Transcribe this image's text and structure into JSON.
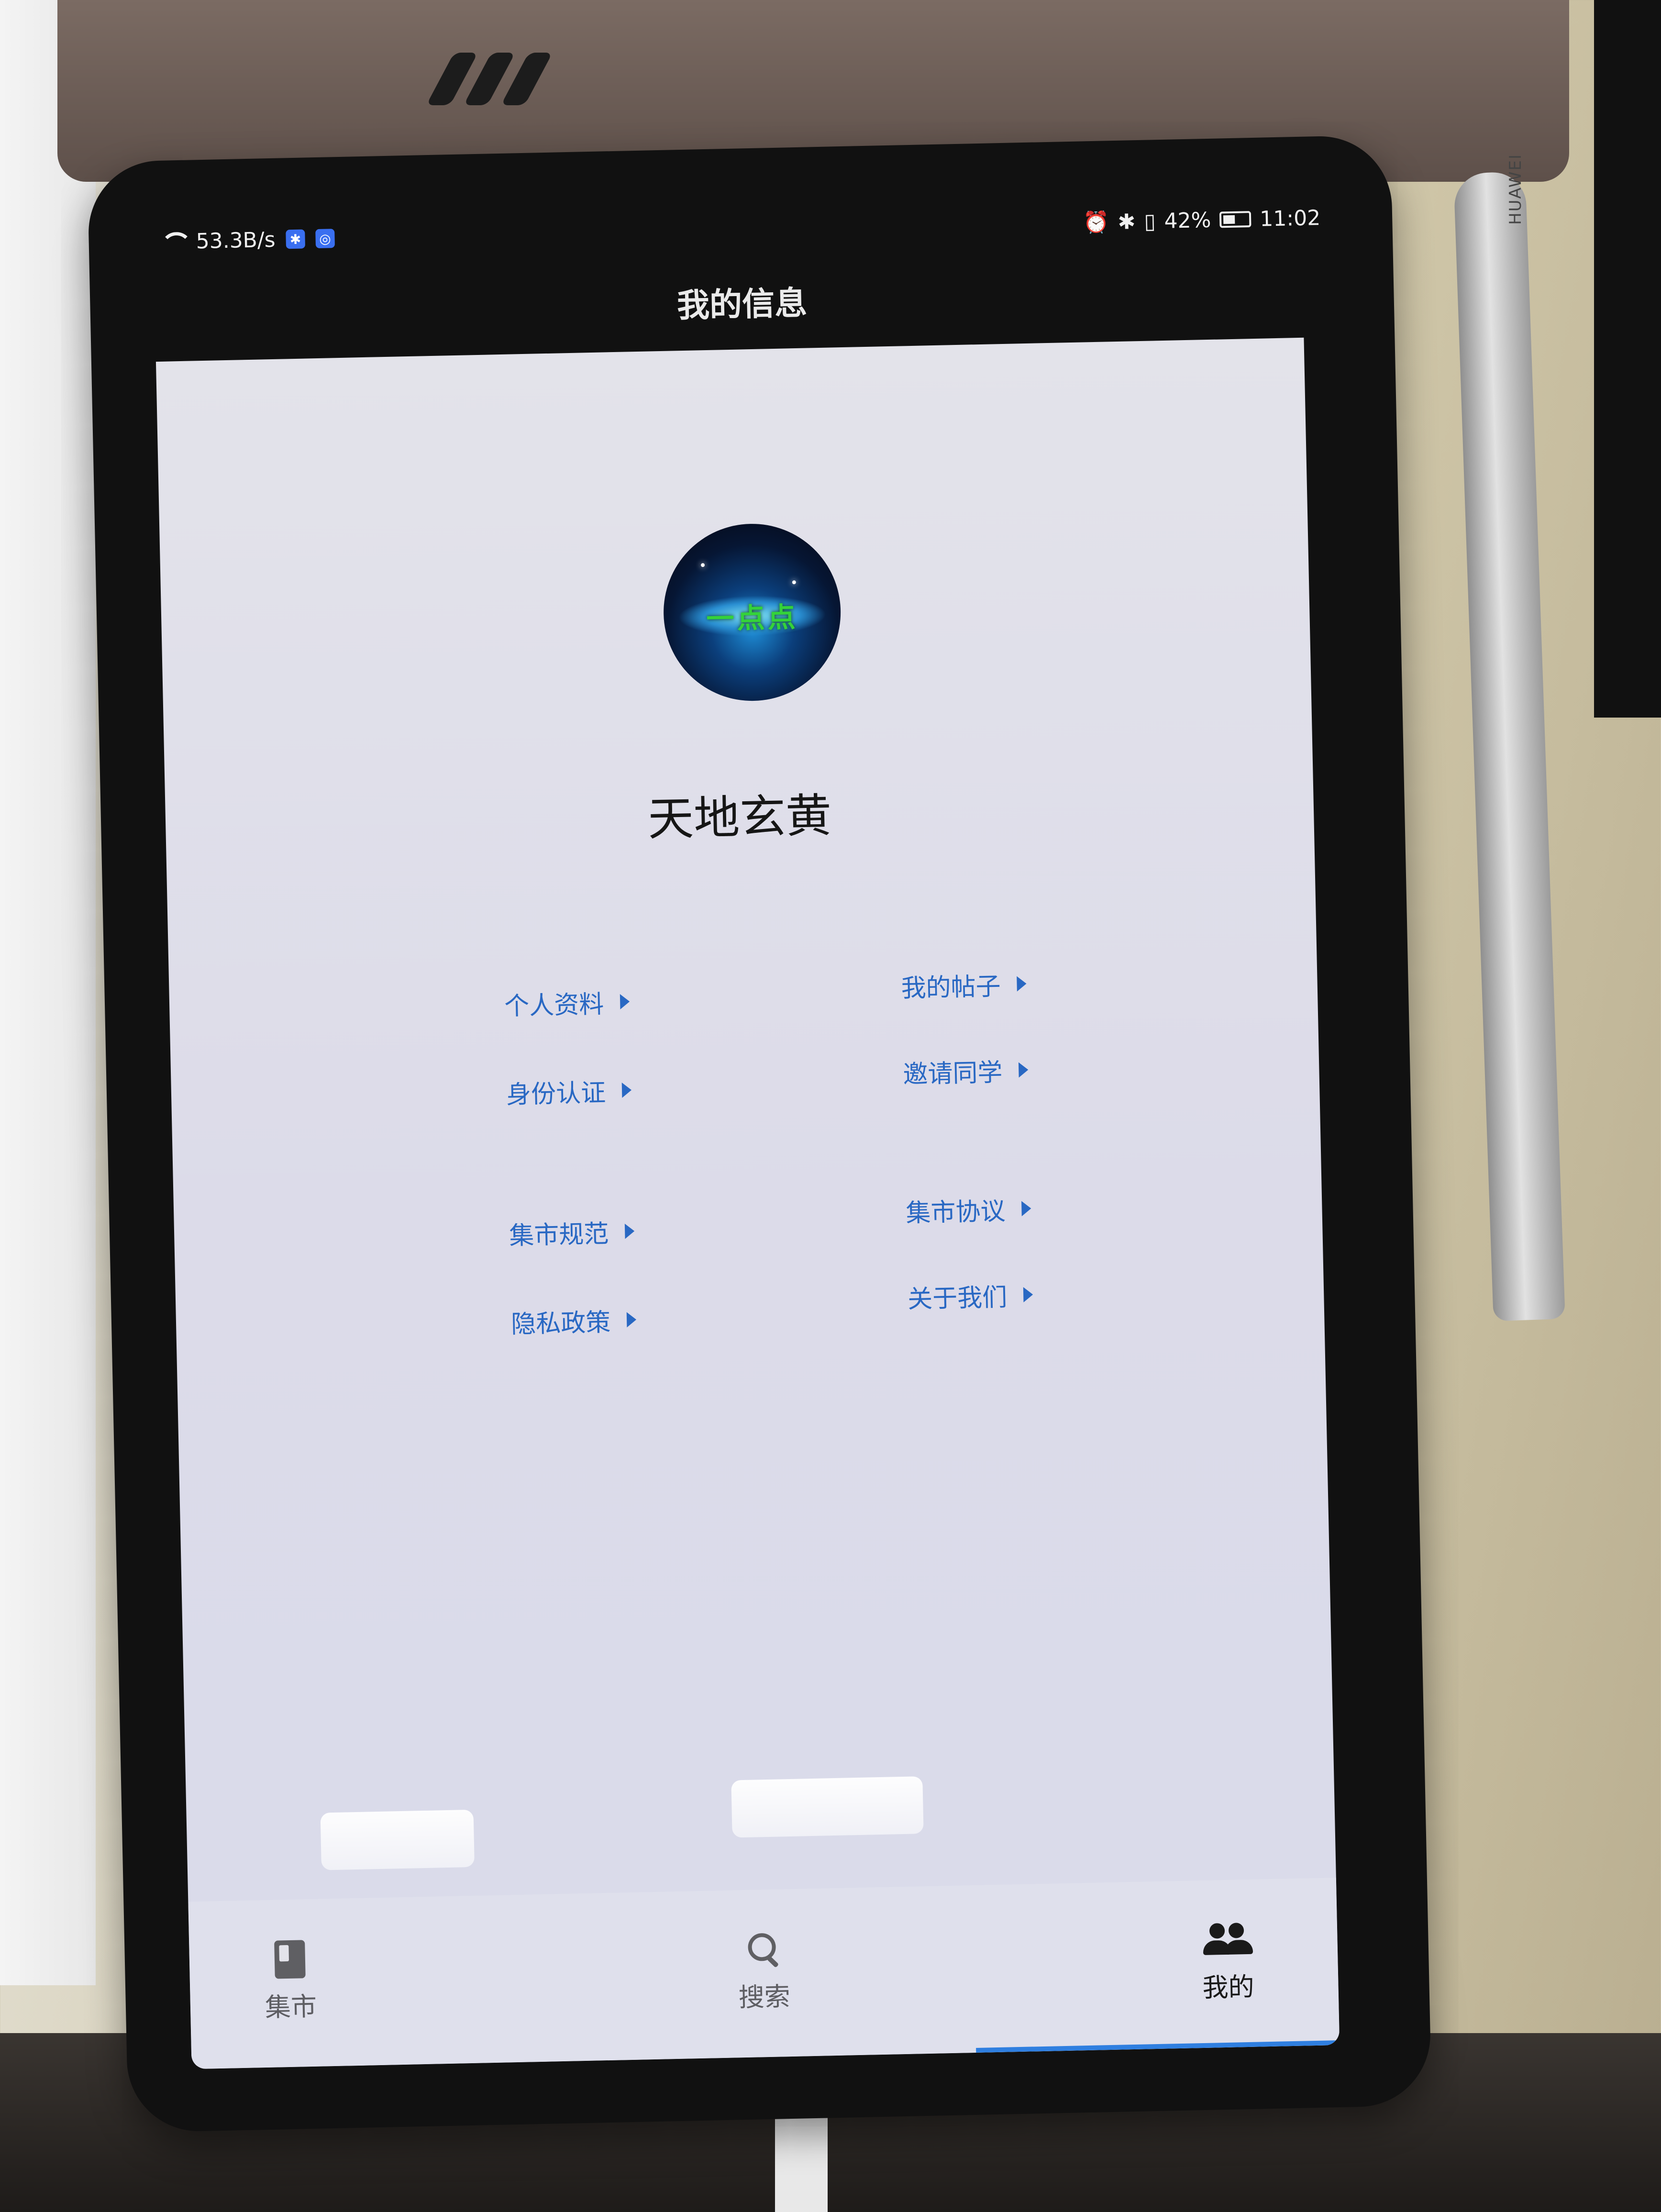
{
  "status_bar": {
    "network_speed": "53.3B/s",
    "battery_percent": "42%",
    "time": "11:02",
    "icons": [
      "wifi-icon",
      "app-badge-icon",
      "app-badge-icon",
      "alarm-icon",
      "bluetooth-icon",
      "vibrate-icon",
      "battery-icon"
    ]
  },
  "header": {
    "title": "我的信息"
  },
  "profile": {
    "username": "天地玄黄",
    "avatar_text": "一点点"
  },
  "menu": {
    "left": [
      {
        "label": "个人资料"
      },
      {
        "label": "身份认证"
      },
      {
        "label": "集市规范"
      },
      {
        "label": "隐私政策"
      }
    ],
    "right": [
      {
        "label": "我的帖子"
      },
      {
        "label": "邀请同学"
      },
      {
        "label": "集市协议"
      },
      {
        "label": "关于我们"
      }
    ]
  },
  "bottom_nav": {
    "items": [
      {
        "label": "集市",
        "icon": "book-icon",
        "active": false
      },
      {
        "label": "搜索",
        "icon": "search-icon",
        "active": false
      },
      {
        "label": "我的",
        "icon": "people-icon",
        "active": true
      }
    ],
    "active_color": "#2f7fe0"
  },
  "scene": {
    "pencil_brand": "HUAWEI"
  },
  "colors": {
    "link_blue": "#2968c3",
    "screen_bg": "#e3e3ea",
    "bezel": "#111111"
  }
}
